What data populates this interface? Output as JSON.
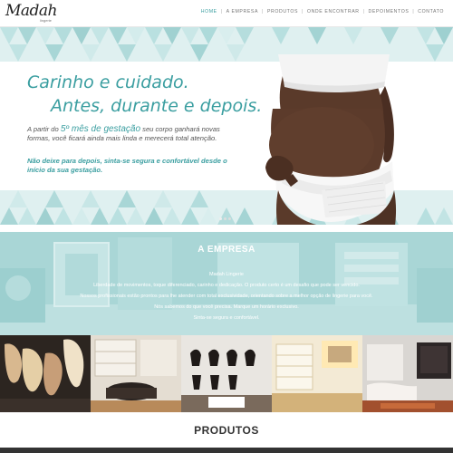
{
  "brand": {
    "logo_text": "Madah",
    "logo_sub": "lingerie"
  },
  "nav": {
    "items": [
      "HOME",
      "A EMPRESA",
      "PRODUTOS",
      "ONDE ENCONTRAR",
      "DEPOIMENTOS",
      "CONTATO"
    ],
    "active": "HOME",
    "accent": "#3a9ea0"
  },
  "hero": {
    "title_line1": "Carinho e cuidado.",
    "title_line2": "Antes, durante e depois.",
    "p1_before": "A partir do ",
    "p1_em": "5º mês de gestação",
    "p1_after": " seu corpo ganhará novas formas, você ficará ainda mais linda e merecerá total atenção.",
    "p2": "Não deixe para depois, sinta-se segura e confortável desde o início da sua gestação.",
    "slides_total": 3,
    "slide_active": 1
  },
  "empresa": {
    "title": "A EMPRESA",
    "lines": [
      "Madah Lingerie",
      "Liberdade de movimentos, toque diferenciado, carinho e dedicação. O produto certo é um desafio que pode ser vencido.",
      "Nossos profissionais estão prontos para lhe atender com total exclusividade, orientando sobre a melhor opção de lingerie para você.",
      "Nós sabemos do que você precisa. Marque um horário exclusivo.",
      "Sinta-se segura e confortável."
    ]
  },
  "photos": [
    "lingerie-display",
    "store-interior-shelves",
    "store-lingerie-wall",
    "store-shelves-light",
    "store-lounge"
  ],
  "produtos": {
    "title": "PRODUTOS"
  },
  "colors": {
    "teal": "#3a9ea0",
    "teal_light": "#a9d6d6"
  }
}
